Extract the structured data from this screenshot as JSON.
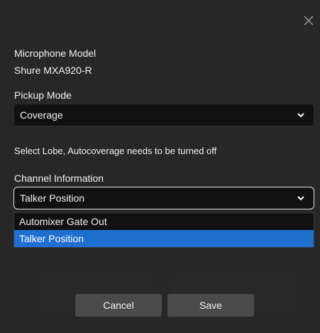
{
  "dialog": {
    "close_icon": "close-icon",
    "microphone_model": {
      "label": "Microphone Model",
      "value": "Shure MXA920-R"
    },
    "pickup_mode": {
      "label": "Pickup Mode",
      "value": "Coverage"
    },
    "notice": "Select Lobe, Autocoverage needs to be turned off",
    "channel_information": {
      "label": "Channel Information",
      "value": "Talker Position",
      "options": [
        "Automixer Gate Out",
        "Talker Position"
      ],
      "selected_index": 1
    },
    "buttons": {
      "cancel": "Cancel",
      "save": "Save"
    }
  },
  "colors": {
    "accent": "#1f6fd1",
    "select_bg": "#111111",
    "button_bg": "#4a4a4a"
  }
}
